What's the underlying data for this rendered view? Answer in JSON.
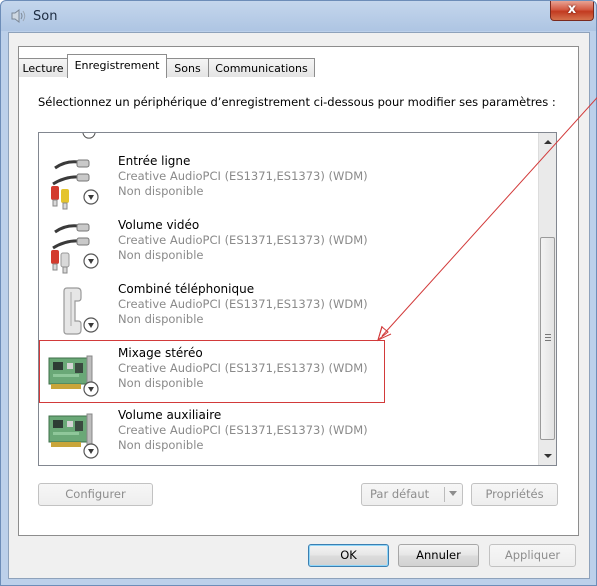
{
  "window": {
    "title": "Son",
    "close_label": "x"
  },
  "tabs": [
    {
      "label": "Lecture"
    },
    {
      "label": "Enregistrement"
    },
    {
      "label": "Sons"
    },
    {
      "label": "Communications"
    }
  ],
  "instruction": "Sélectionnez un périphérique d’enregistrement ci-dessous pour modifier ses paramètres :",
  "devices": [
    {
      "name": "Entrée ligne",
      "driver": "Creative AudioPCI (ES1371,ES1373) (WDM)",
      "status": "Non disponible",
      "icon": "rca-cable-icon"
    },
    {
      "name": "Volume vidéo",
      "driver": "Creative AudioPCI (ES1371,ES1373) (WDM)",
      "status": "Non disponible",
      "icon": "rca-cable-icon"
    },
    {
      "name": "Combiné téléphonique",
      "driver": "Creative AudioPCI (ES1371,ES1373) (WDM)",
      "status": "Non disponible",
      "icon": "phone-handset-icon"
    },
    {
      "name": "Mixage stéréo",
      "driver": "Creative AudioPCI (ES1371,ES1373) (WDM)",
      "status": "Non disponible",
      "icon": "sound-card-icon"
    },
    {
      "name": "Volume auxiliaire",
      "driver": "Creative AudioPCI (ES1371,ES1373) (WDM)",
      "status": "Non disponible",
      "icon": "sound-card-icon"
    }
  ],
  "buttons": {
    "configure": "Configurer",
    "default": "Par défaut",
    "properties": "Propriétés",
    "ok": "OK",
    "cancel": "Annuler",
    "apply": "Appliquer"
  },
  "colors": {
    "annotation": "#d23a3a",
    "title_bar": "#aec5e3",
    "status_icon": "#3a3a3a"
  }
}
